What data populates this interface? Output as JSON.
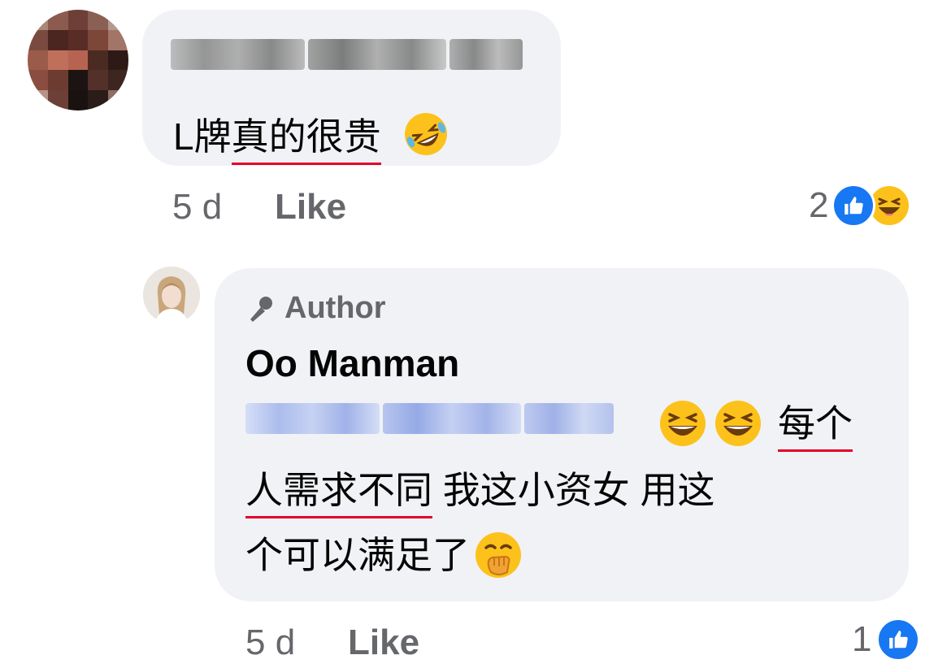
{
  "comment1": {
    "text_prefix": "L牌",
    "text_underlined": "真的很贵",
    "time": "5 d",
    "like": "Like",
    "reaction_count": "2",
    "reactions": [
      "like-icon",
      "haha-icon"
    ]
  },
  "reply1": {
    "badge": "Author",
    "name": "Oo Manman",
    "line1_underlined": "每个",
    "line2_underlined": "人需求不同",
    "line2_rest": " 我这小资女 用这",
    "line3": "个可以满足了",
    "time": "5 d",
    "like": "Like",
    "reaction_count": "1",
    "reactions": [
      "like-icon"
    ]
  },
  "colors": {
    "bubble": "#f0f2f5",
    "meta": "#65676b",
    "underline": "#e4002b",
    "like_blue": "#1877f2"
  }
}
